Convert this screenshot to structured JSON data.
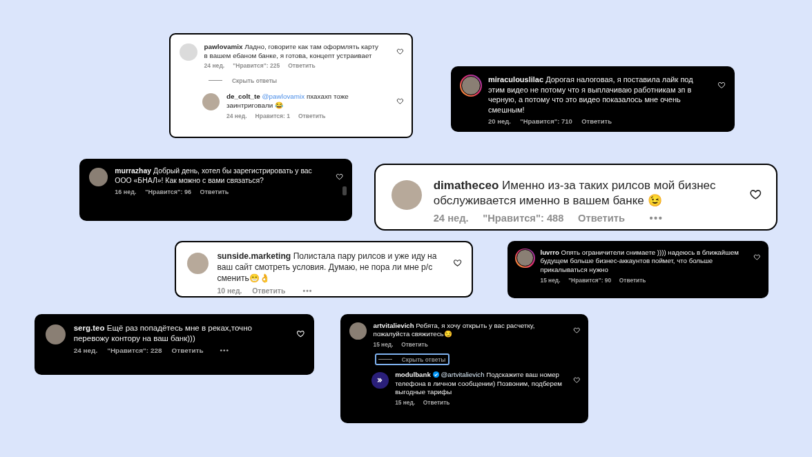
{
  "cards": [
    {
      "dark": false,
      "items": [
        {
          "kind": "comment",
          "photo": false,
          "story_ring": false,
          "username": "pawlovamix",
          "text": "Ладно, говорите как там оформлять карту в вашем ебаном банке, я готова, концепт устраивает",
          "time": "24 нед.",
          "likes": "\"Нравится\": 225",
          "reply": "Ответить"
        },
        {
          "kind": "toggle",
          "label": "Скрыть ответы",
          "highlighted": false
        },
        {
          "kind": "reply",
          "photo": true,
          "story_ring": false,
          "username": "de_colt_te",
          "mention": "@pawlovamix",
          "text": "пхахахп тоже заинтриговали 😂",
          "time": "24 нед.",
          "likes": "Нравится: 1",
          "reply": "Ответить"
        }
      ]
    },
    {
      "dark": true,
      "items": [
        {
          "kind": "comment",
          "photo": true,
          "story_ring": true,
          "username": "miraculouslilac",
          "text": "Дорогая налоговая, я поставила лайк под этим видео не потому что я выплачиваю работникам зп в черную, а потому что это видео показалось мне очень смешным!",
          "time": "20 нед.",
          "likes": "\"Нравится\": 710",
          "reply": "Ответить"
        }
      ]
    },
    {
      "dark": true,
      "items": [
        {
          "kind": "comment",
          "photo": true,
          "story_ring": false,
          "username": "murrazhay",
          "text": "Добрый день, хотел бы зарегистрировать у вас ООО «БНАЛ»! Как можно с вами связаться?",
          "time": "16 нед.",
          "likes": "\"Нравится\": 96",
          "reply": "Ответить"
        }
      ]
    },
    {
      "dark": false,
      "items": [
        {
          "kind": "comment",
          "photo": true,
          "story_ring": false,
          "username": "dimatheceo",
          "text": "Именно из-за таких рилсов мой бизнес обслуживается именно в вашем банке 😉",
          "time": "24 нед.",
          "likes": "\"Нравится\": 488",
          "reply": "Ответить",
          "more": "•••"
        }
      ]
    },
    {
      "dark": false,
      "items": [
        {
          "kind": "comment",
          "photo": true,
          "story_ring": false,
          "username": "sunside.marketing",
          "text": "Полистала пару рилсов и уже иду на ваш сайт смотреть условия. Думаю, не пора ли мне р/с сменить😁👌",
          "time": "10 нед.",
          "reply": "Ответить",
          "more": "•••"
        }
      ]
    },
    {
      "dark": true,
      "items": [
        {
          "kind": "comment",
          "photo": true,
          "story_ring": true,
          "username": "luvrro",
          "text": "Опять ограничители снимаете )))) надеюсь в ближайшем будущем больше бизнес-аккаунтов поймет, что больше прикалываться нужно",
          "time": "15 нед.",
          "likes": "\"Нравится\": 90",
          "reply": "Ответить"
        }
      ]
    },
    {
      "dark": true,
      "items": [
        {
          "kind": "comment",
          "photo": true,
          "story_ring": false,
          "username": "serg.teo",
          "text": "Ещё раз попадётесь мне в реках,точно перевожу контору на ваш банк)))",
          "time": "24 нед.",
          "likes": "\"Нравится\": 228",
          "reply": "Ответить",
          "more": "•••"
        }
      ]
    },
    {
      "dark": true,
      "items": [
        {
          "kind": "comment",
          "photo": true,
          "story_ring": false,
          "username": "artvitalievich",
          "text": "Ребята, я хочу открыть у вас расчетку, пожалуйста свяжитесь😏",
          "time": "15 нед.",
          "reply": "Ответить"
        },
        {
          "kind": "toggle",
          "label": "Скрыть ответы",
          "highlighted": true
        },
        {
          "kind": "reply",
          "logo": true,
          "story_ring": false,
          "username": "modulbank",
          "verified": true,
          "mention": "@artvitalievich",
          "text": "Подскажите ваш номер телефона в личном сообщении) Позвоним, подберем выгодные тарифы",
          "time": "15 нед.",
          "reply": "Ответить"
        }
      ]
    }
  ]
}
